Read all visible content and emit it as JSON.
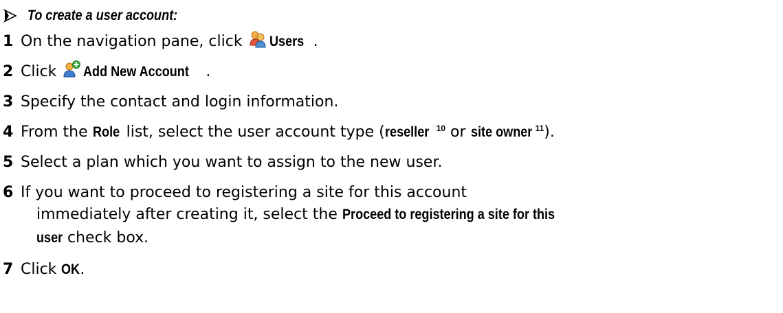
{
  "heading": "To create a user account:",
  "steps": {
    "s1": {
      "num": "1",
      "pre": "On the navigation pane, click ",
      "ui": "Users",
      "post": "."
    },
    "s2": {
      "num": "2",
      "pre": "Click ",
      "ui": "Add New Account",
      "post": "."
    },
    "s3": {
      "num": "3",
      "text": "Specify the contact and login information."
    },
    "s4": {
      "num": "4",
      "pre": "From the ",
      "ui_role": "Role",
      "mid": " list, select the user account type (",
      "ui_reseller": "reseller",
      "sup_reseller": "10",
      "or": " or ",
      "ui_site_owner": "site owner",
      "sup_site_owner": "11",
      "post": ")."
    },
    "s5": {
      "num": "5",
      "text": "Select a plan which you want to assign to the new user."
    },
    "s6": {
      "num": "6",
      "line1": "If you want to proceed to registering a site for this account",
      "line2_pre": "immediately after creating it, select the ",
      "line2_ui": "Proceed to registering a site for this",
      "line3_ui": "user",
      "line3_post": " check box."
    },
    "s7": {
      "num": "7",
      "pre": "Click ",
      "ui": "OK",
      "post": "."
    }
  },
  "icons": {
    "users": "users-icon",
    "add_account": "add-account-icon",
    "heading_arrow": "arrow-bullet-icon"
  }
}
